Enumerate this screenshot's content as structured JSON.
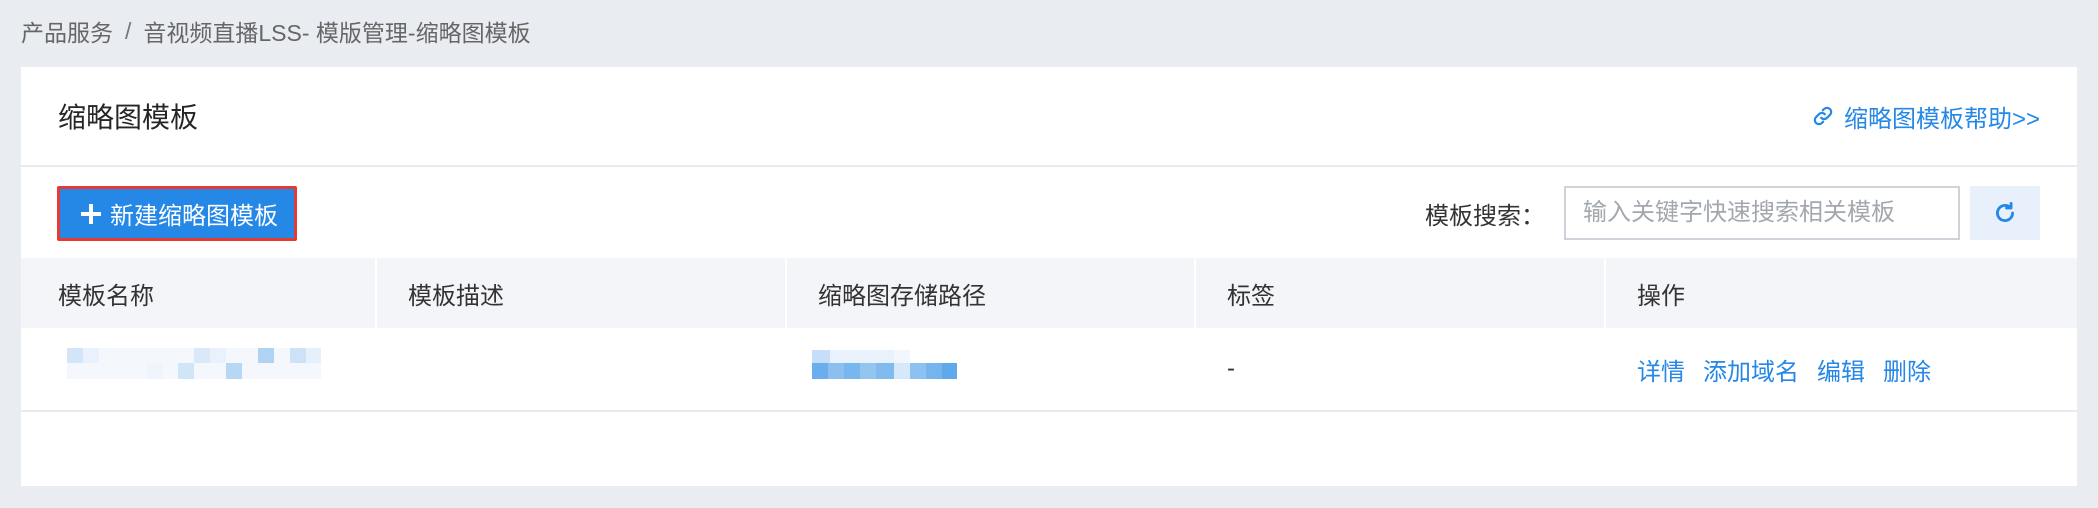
{
  "breadcrumb": {
    "items": [
      "产品服务",
      "音视频直播LSS- 模版管理-缩略图模板"
    ],
    "separator": "/"
  },
  "page": {
    "title": "缩略图模板",
    "help_link": "缩略图模板帮助>>",
    "help_icon": "link-icon"
  },
  "toolbar": {
    "create_label": "新建缩略图模板",
    "create_icon": "plus-icon",
    "search_label": "模板搜索：",
    "search_placeholder": "输入关键字快速搜索相关模板",
    "refresh_icon": "refresh-icon"
  },
  "table": {
    "columns": [
      "模板名称",
      "模板描述",
      "缩略图存储路径",
      "标签",
      "操作"
    ],
    "rows": [
      {
        "tag": "-",
        "actions": [
          "详情",
          "添加域名",
          "编辑",
          "删除"
        ]
      }
    ]
  },
  "colors": {
    "accent": "#2587e6",
    "highlight": "#e53935",
    "page_bg": "#e9ecf1"
  }
}
